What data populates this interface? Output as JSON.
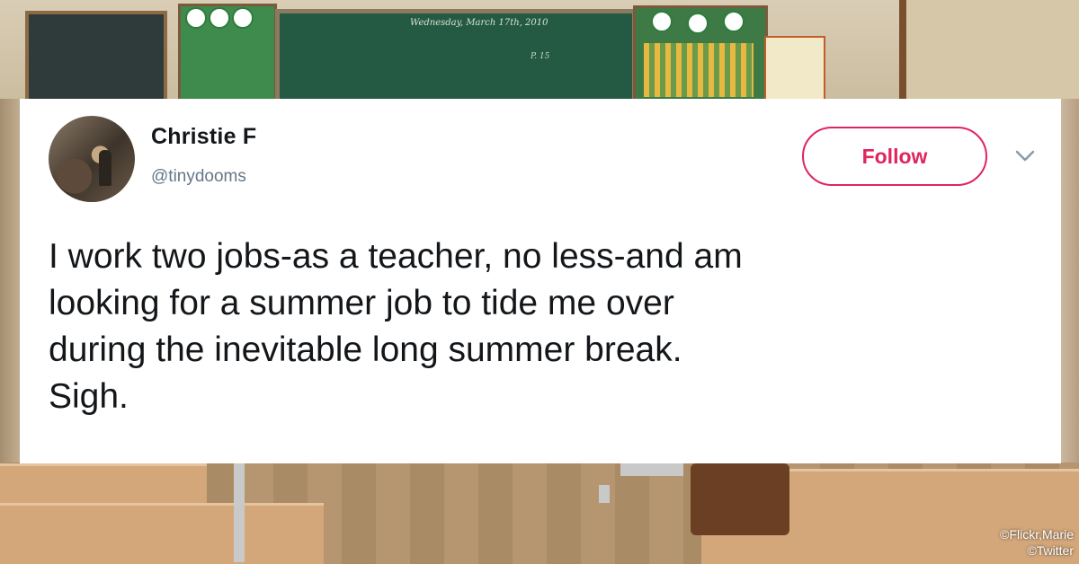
{
  "tweet": {
    "author_name": "Christie F",
    "handle": "@tinydooms",
    "follow_label": "Follow",
    "text": "I work two jobs-as a teacher, no less-and am\nlooking for a summer job to tide me over\nduring the inevitable long summer break.\nSigh."
  },
  "background": {
    "chalkboard_text": "Wednesday, March 17th, 2010",
    "chalkboard_note": "P. 15"
  },
  "credits": {
    "line1": "©Flickr,Marie",
    "line2": "©Twitter"
  },
  "colors": {
    "follow_accent": "#e0245e",
    "handle_gray": "#657786",
    "text_dark": "#14171a"
  },
  "icons": {
    "menu": "chevron-down-icon",
    "avatar": "profile-photo"
  }
}
